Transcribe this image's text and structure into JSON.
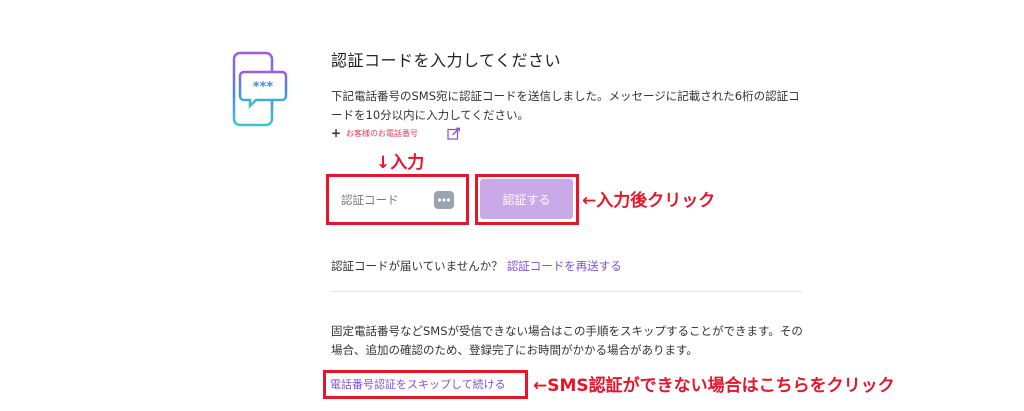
{
  "header": {
    "title": "認証コードを入力してください",
    "description": "下記電話番号のSMS宛に認証コードを送信しました。メッセージに記載された6桁の認証コードを10分以内に入力してください。"
  },
  "phone": {
    "plus": "+",
    "label": "お客様のお電話番号"
  },
  "code_form": {
    "placeholder": "認証コード",
    "submit_label": "認証する"
  },
  "resend": {
    "question": "認証コードが届いていませんか？",
    "link": "認証コードを再送する"
  },
  "skip": {
    "description": "固定電話番号などSMSが受信できない場合はこの手順をスキップすることができます。その場合、追加の確認のため、登録完了にお時間がかかる場合があります。",
    "link": "電話番号認証をスキップして続ける"
  },
  "annotations": {
    "input": "↓入力",
    "click_after_input": "←入力後クリック",
    "sms_fail": "←SMS認証ができない場合はこちらをクリック"
  },
  "colors": {
    "accent": "#8550d8",
    "button": "#c9a9e8",
    "annotation": "#e3162a",
    "phone_label": "#e0405a"
  },
  "icons": {
    "logo": "phone-password-icon",
    "edit": "edit-icon",
    "dots": "password-dots-icon"
  }
}
